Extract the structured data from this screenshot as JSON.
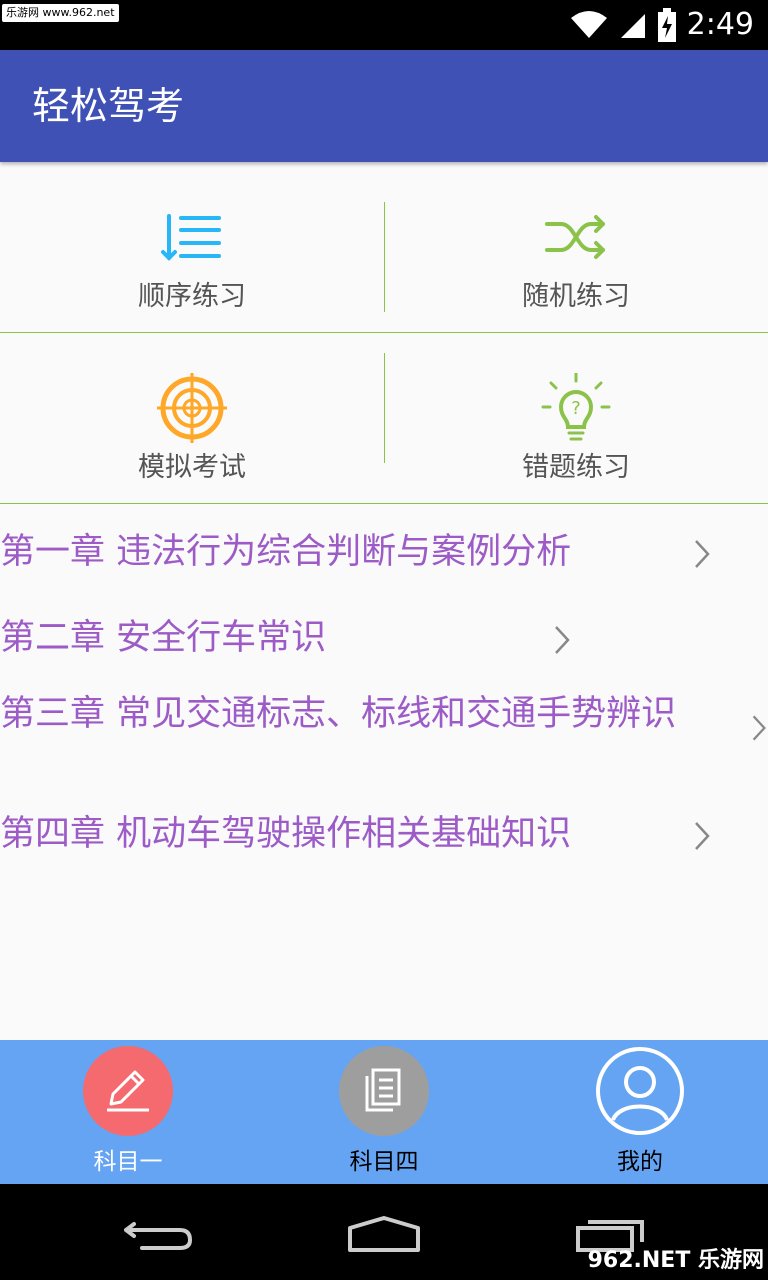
{
  "status_bar": {
    "watermark": "乐游网 www.962.net",
    "time": "2:49",
    "icons": [
      "wifi-icon",
      "cell-signal-icon",
      "battery-charging-icon"
    ]
  },
  "app_bar": {
    "title": "轻松驾考"
  },
  "grid": {
    "items": [
      {
        "label": "顺序练习",
        "icon": "sequential-list-icon",
        "color": "#29b6f6"
      },
      {
        "label": "随机练习",
        "icon": "shuffle-icon",
        "color": "#8bc34a"
      },
      {
        "label": "模拟考试",
        "icon": "target-icon",
        "color": "#ffa726"
      },
      {
        "label": "错题练习",
        "icon": "lightbulb-question-icon",
        "color": "#8bc34a"
      }
    ]
  },
  "chapters": [
    {
      "title": "第一章 违法行为综合判断与案例分析"
    },
    {
      "title": "第二章 安全行车常识"
    },
    {
      "title": "第三章 常见交通标志、标线和交通手势辨识"
    },
    {
      "title": "第四章 机动车驾驶操作相关基础知识"
    }
  ],
  "bottom_nav": {
    "items": [
      {
        "label": "科目一",
        "icon": "pencil-icon",
        "circle_color": "#f46a6f",
        "label_color": "#ffffff"
      },
      {
        "label": "科目四",
        "icon": "documents-icon",
        "circle_color": "#9e9e9e",
        "label_color": "#000000"
      },
      {
        "label": "我的",
        "icon": "user-icon",
        "circle_color": "#ffffff",
        "label_color": "#000000"
      }
    ]
  },
  "system_nav": {
    "watermark": "962.NET 乐游网"
  },
  "colors": {
    "app_bar": "#3f51b5",
    "chapter_text": "#9c5bc7",
    "divider": "#8bc34a",
    "bottom_nav": "#64a4f2"
  }
}
